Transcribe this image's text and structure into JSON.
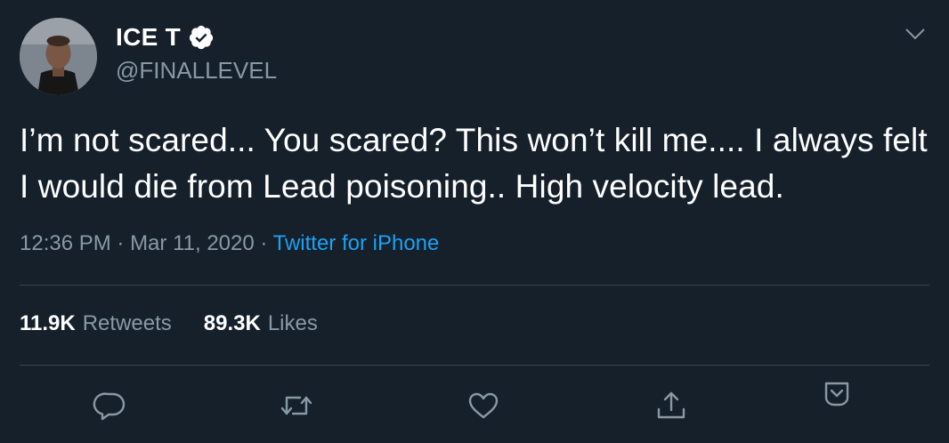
{
  "author": {
    "name": "ICE T",
    "handle": "@FINALLEVEL",
    "verified": true
  },
  "tweet": {
    "text": "I’m not scared... You scared? This won’t kill me.... I always felt I would die from Lead poisoning.. High velocity lead.",
    "time": "12:36 PM",
    "separator": " · ",
    "date": "Mar 11, 2020",
    "source": "Twitter for iPhone"
  },
  "stats": {
    "retweets_count": "11.9K",
    "retweets_label": "Retweets",
    "likes_count": "89.3K",
    "likes_label": "Likes"
  },
  "actions": [
    "reply-icon",
    "retweet-icon",
    "like-icon",
    "share-icon",
    "more-actions-icon"
  ],
  "colors": {
    "background": "#15202b",
    "text": "#ffffff",
    "secondary": "#8899a6",
    "accent": "#1da1f2",
    "divider": "#38444d"
  }
}
